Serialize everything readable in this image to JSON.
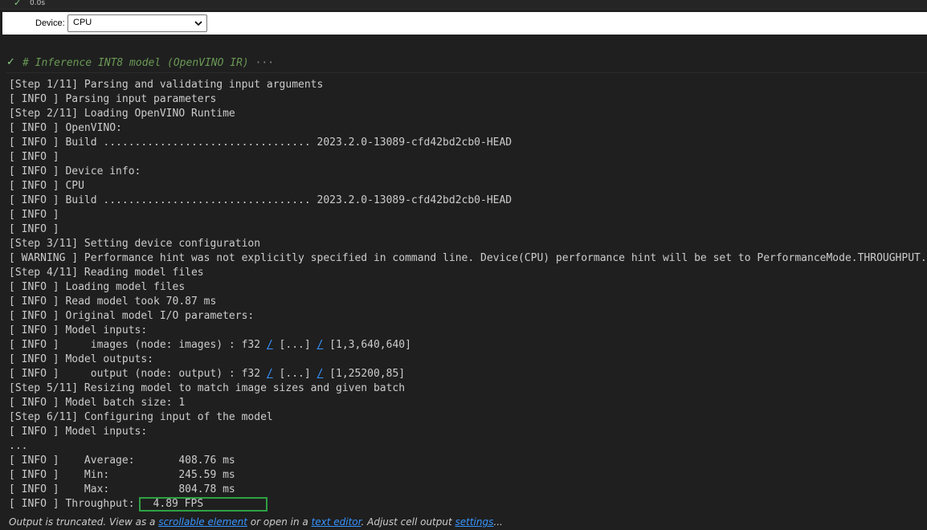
{
  "top_status": {
    "check": "✓",
    "time": "0.0s"
  },
  "device_widget": {
    "label": "Device:",
    "selected": "CPU"
  },
  "cell": {
    "check": "✓",
    "code": "# Inference INT8 model (OpenVINO IR)",
    "ellipsis": "···"
  },
  "output_lines": [
    "[Step 1/11] Parsing and validating input arguments",
    "[ INFO ] Parsing input parameters",
    "[Step 2/11] Loading OpenVINO Runtime",
    "[ INFO ] OpenVINO:",
    "[ INFO ] Build ................................. 2023.2.0-13089-cfd42bd2cb0-HEAD",
    "[ INFO ]",
    "[ INFO ] Device info:",
    "[ INFO ] CPU",
    "[ INFO ] Build ................................. 2023.2.0-13089-cfd42bd2cb0-HEAD",
    "[ INFO ]",
    "[ INFO ]",
    "[Step 3/11] Setting device configuration",
    "[ WARNING ] Performance hint was not explicitly specified in command line. Device(CPU) performance hint will be set to PerformanceMode.THROUGHPUT.",
    "[Step 4/11] Reading model files",
    "[ INFO ] Loading model files",
    "[ INFO ] Read model took 70.87 ms",
    "[ INFO ] Original model I/O parameters:",
    "[ INFO ] Model inputs:"
  ],
  "input_line": {
    "prefix": "[ INFO ]     images (node: images) : f32 ",
    "link1": "/",
    "mid": " [...] ",
    "link2": "/",
    "suffix": " [1,3,640,640]"
  },
  "outputs_header": "[ INFO ] Model outputs:",
  "output_line": {
    "prefix": "[ INFO ]     output (node: output) : f32 ",
    "link1": "/",
    "mid": " [...] ",
    "link2": "/",
    "suffix": " [1,25200,85]"
  },
  "output_lines_2": [
    "[Step 5/11] Resizing model to match image sizes and given batch",
    "[ INFO ] Model batch size: 1",
    "[Step 6/11] Configuring input of the model",
    "[ INFO ] Model inputs:",
    "...",
    "[ INFO ]    Average:       408.76 ms",
    "[ INFO ]    Min:           245.59 ms",
    "[ INFO ]    Max:           804.78 ms"
  ],
  "throughput": {
    "prefix": "[ INFO ] Throughput:",
    "value": "4.89 FPS"
  },
  "footer": {
    "text1": "Output is truncated. View as a ",
    "link1": "scrollable element",
    "text2": " or open in a ",
    "link2": "text editor",
    "text3": ". Adjust cell output ",
    "link3": "settings",
    "text4": "..."
  },
  "colors": {
    "background": "#1f1f1f",
    "success": "#89d185",
    "link": "#3794ff",
    "highlight_box": "#2ea043"
  }
}
